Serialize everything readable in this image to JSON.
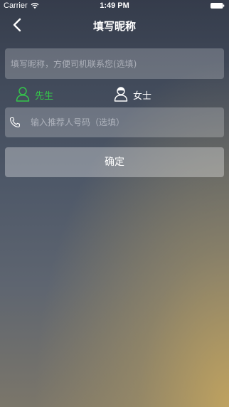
{
  "status_bar": {
    "carrier": "Carrier",
    "time": "1:49 PM",
    "wifi_icon": "wifi-icon",
    "battery_icon": "battery-icon"
  },
  "nav": {
    "title": "填写昵称",
    "back_icon": "chevron-left-icon"
  },
  "form": {
    "nickname_placeholder": "填写昵称，方便司机联系您(选填)",
    "nickname_value": "",
    "gender": {
      "selected": "male",
      "options": [
        {
          "label": "先生",
          "icon": "man-icon",
          "color": "#34c84a"
        },
        {
          "label": "女士",
          "icon": "woman-icon",
          "color": "#ffffff"
        }
      ]
    },
    "referrer_placeholder": "输入推荐人号码（选填）",
    "referrer_value": "",
    "referrer_icon": "phone-icon"
  },
  "confirm_button": {
    "label": "确定"
  }
}
